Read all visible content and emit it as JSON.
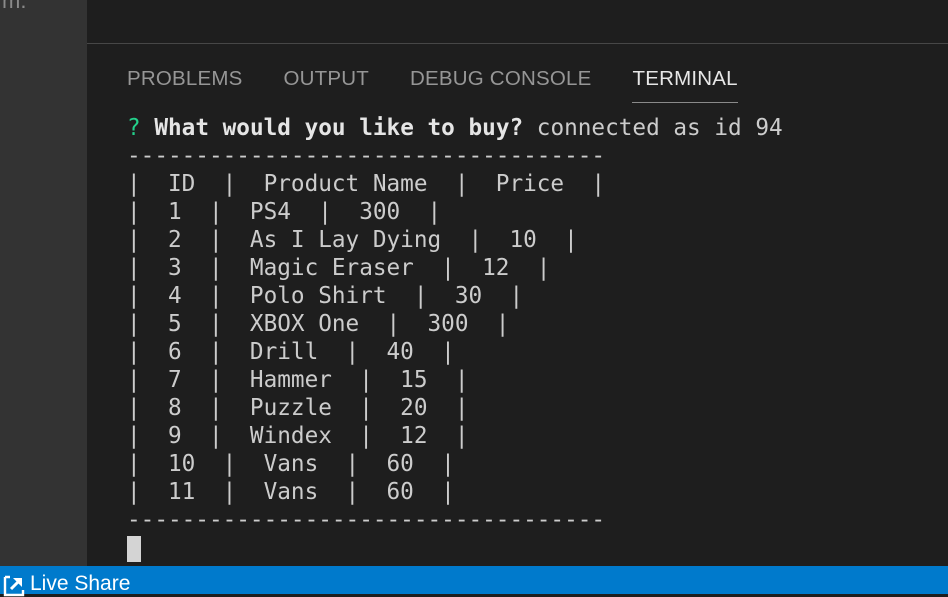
{
  "sidebar": {
    "fragment_text": "m."
  },
  "panel": {
    "tabs": [
      {
        "label": "PROBLEMS",
        "active": false
      },
      {
        "label": "OUTPUT",
        "active": false
      },
      {
        "label": "DEBUG CONSOLE",
        "active": false
      },
      {
        "label": "TERMINAL",
        "active": true
      }
    ]
  },
  "terminal": {
    "prompt_symbol": "?",
    "prompt_question": "What would you like to buy?",
    "prompt_after": " connected as id 94",
    "lines": [
      "-----------------------------------",
      "|  ID  |  Product Name  |  Price  |",
      "|  1  |  PS4  |  300  |",
      "|  2  |  As I Lay Dying  |  10  |",
      "|  3  |  Magic Eraser  |  12  |",
      "|  4  |  Polo Shirt  |  30  |",
      "|  5  |  XBOX One  |  300  |",
      "|  6  |  Drill  |  40  |",
      "|  7  |  Hammer  |  15  |",
      "|  8  |  Puzzle  |  20  |",
      "|  9  |  Windex  |  12  |",
      "|  10  |  Vans  |  60  |",
      "|  11  |  Vans  |  60  |",
      "-----------------------------------"
    ]
  },
  "statusbar": {
    "live_share_label": "Live Share",
    "live_share_icon": "live-share-icon",
    "background": "#007acc"
  }
}
